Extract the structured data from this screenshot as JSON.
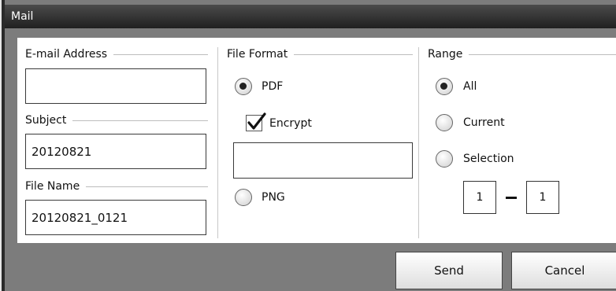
{
  "window": {
    "title": "Mail"
  },
  "left": {
    "email_label": "E-mail Address",
    "email_value": "",
    "subject_label": "Subject",
    "subject_value": "20120821",
    "filename_label": "File Name",
    "filename_value": "20120821_0121"
  },
  "format": {
    "title": "File Format",
    "pdf_label": "PDF",
    "pdf_selected": true,
    "encrypt_label": "Encrypt",
    "encrypt_checked": true,
    "encrypt_value": "",
    "png_label": "PNG",
    "png_selected": false
  },
  "range": {
    "title": "Range",
    "options": [
      {
        "label": "All",
        "selected": true
      },
      {
        "label": "Current",
        "selected": false
      },
      {
        "label": "Selection",
        "selected": false
      }
    ],
    "from": "1",
    "to": "1"
  },
  "buttons": {
    "send": "Send",
    "cancel": "Cancel"
  }
}
